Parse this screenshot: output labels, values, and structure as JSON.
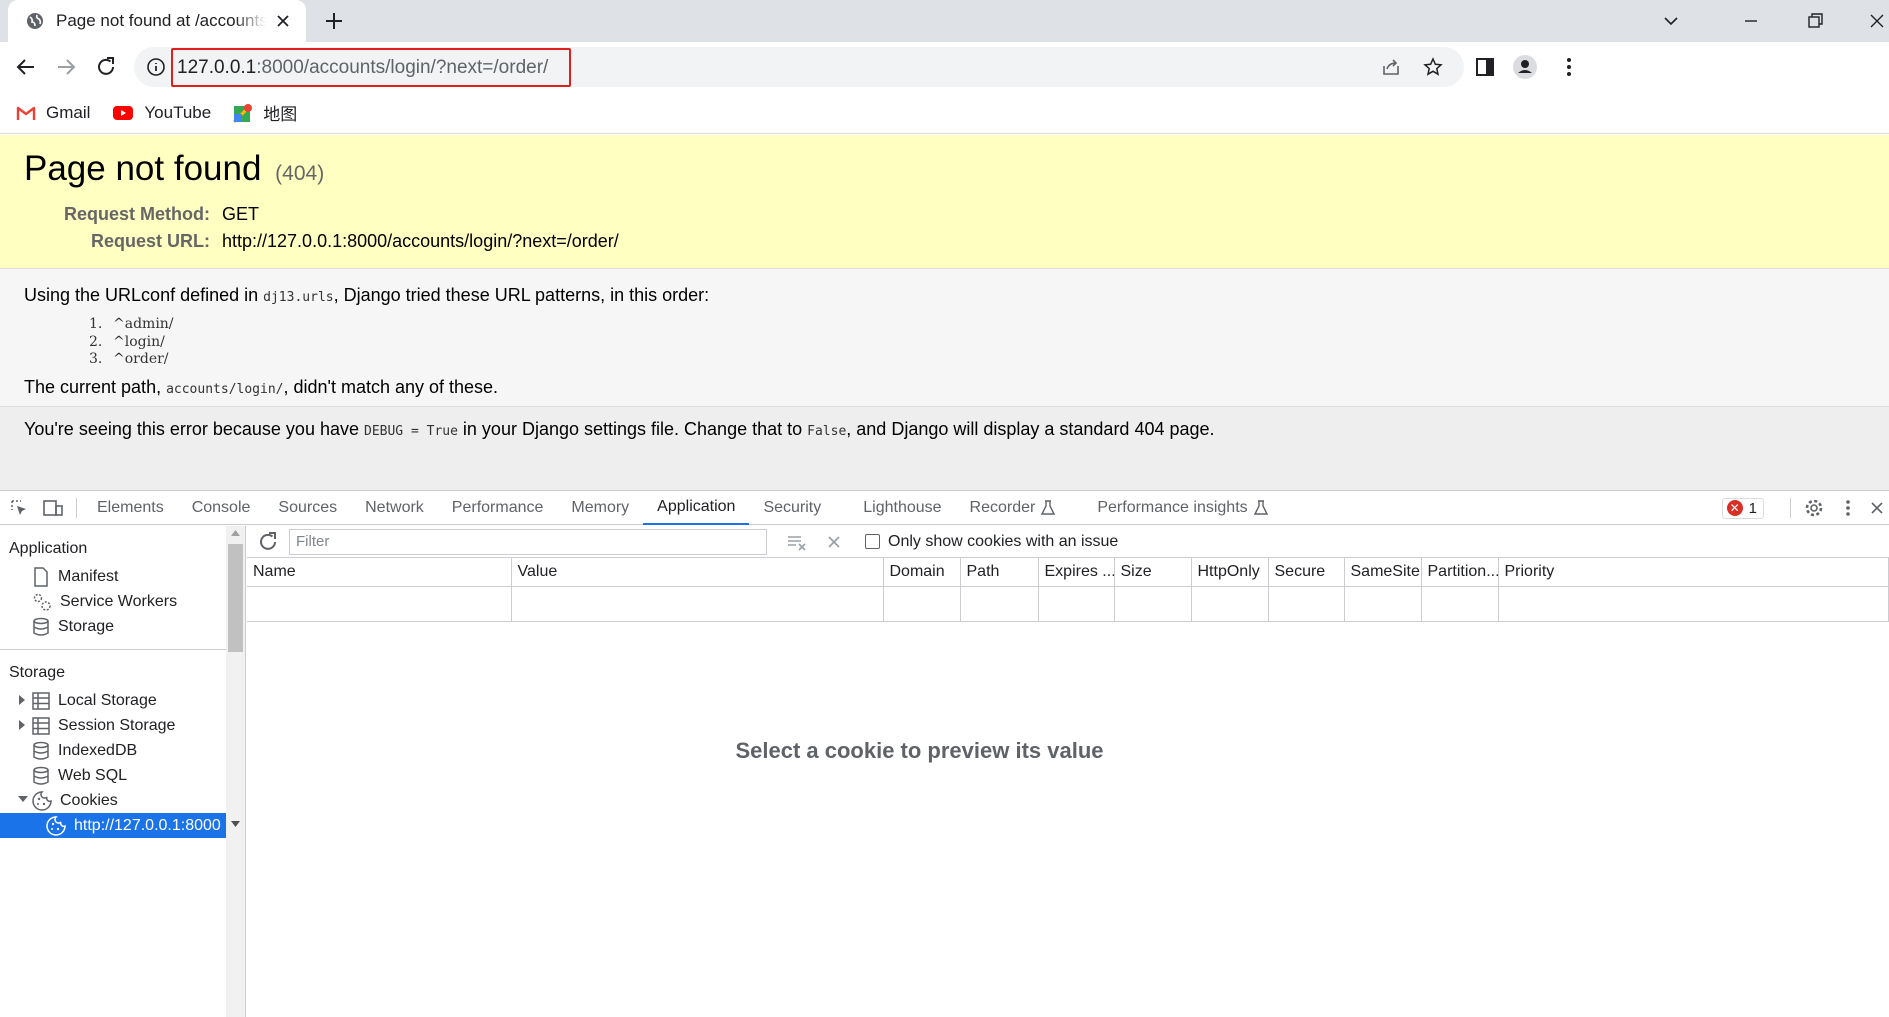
{
  "browser": {
    "tab_title": "Page not found at /accounts/login/",
    "url_host": "127.0.0.1",
    "url_rest": ":8000/accounts/login/?next=/order/"
  },
  "bookmarks": [
    {
      "label": "Gmail",
      "icon": "gmail-icon"
    },
    {
      "label": "YouTube",
      "icon": "youtube-icon"
    },
    {
      "label": "地图",
      "icon": "maps-icon"
    }
  ],
  "page": {
    "title": "Page not found",
    "code": "(404)",
    "request_method_label": "Request Method:",
    "request_method": "GET",
    "request_url_label": "Request URL:",
    "request_url": "http://127.0.0.1:8000/accounts/login/?next=/order/",
    "urlconf_before": "Using the URLconf defined in ",
    "urlconf_module": "dj13.urls",
    "urlconf_after": ", Django tried these URL patterns, in this order:",
    "patterns": [
      {
        "n": "1.",
        "p": "^admin/"
      },
      {
        "n": "2.",
        "p": "^login/"
      },
      {
        "n": "3.",
        "p": "^order/"
      }
    ],
    "current_before": "The current path, ",
    "current_path": "accounts/login/",
    "current_after": ", didn't match any of these.",
    "expl_1": "You're seeing this error because you have ",
    "expl_debug": "DEBUG = True",
    "expl_2": " in your Django settings file. Change that to ",
    "expl_false": "False",
    "expl_3": ", and Django will display a standard 404 page."
  },
  "devtools": {
    "tabs": [
      "Elements",
      "Console",
      "Sources",
      "Network",
      "Performance",
      "Memory",
      "Application",
      "Security",
      "Lighthouse",
      "Recorder",
      "Performance insights"
    ],
    "active_tab": "Application",
    "error_count": "1",
    "sidebar": {
      "application_head": "Application",
      "application_items": [
        "Manifest",
        "Service Workers",
        "Storage"
      ],
      "storage_head": "Storage",
      "storage_items": [
        "Local Storage",
        "Session Storage",
        "IndexedDB",
        "Web SQL",
        "Cookies"
      ],
      "cookie_origin": "http://127.0.0.1:8000"
    },
    "filter_placeholder": "Filter",
    "only_issue_label": "Only show cookies with an issue",
    "columns": [
      "Name",
      "Value",
      "Domain",
      "Path",
      "Expires ...",
      "Size",
      "HttpOnly",
      "Secure",
      "SameSite",
      "Partition...",
      "Priority"
    ],
    "preview_text": "Select a cookie to preview its value"
  },
  "colors": {
    "accent": "#1a73e8",
    "highlight_box": "#e0201e",
    "summary_bg": "#ffffc2"
  }
}
